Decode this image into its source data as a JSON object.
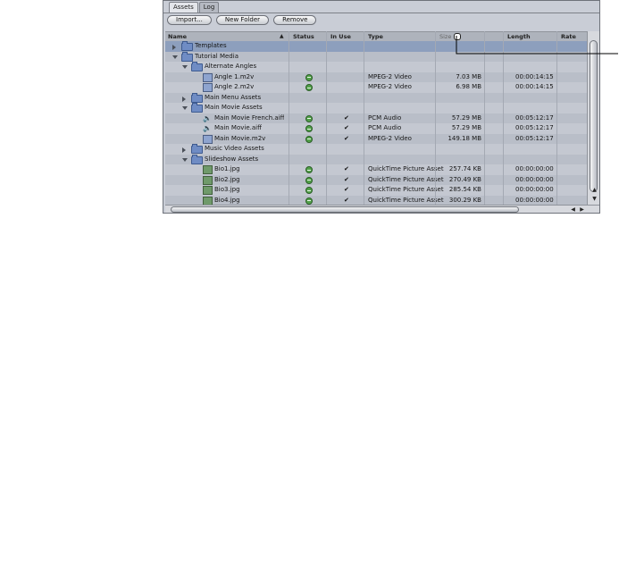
{
  "tabs": [
    {
      "label": "Assets"
    },
    {
      "label": "Log"
    }
  ],
  "toolbar": {
    "import": "Import...",
    "new_folder": "New Folder",
    "remove": "Remove"
  },
  "columns": [
    "Name",
    "Status",
    "In Use",
    "Type",
    "Size",
    "Length",
    "Rate"
  ],
  "rows": [
    {
      "name": "Templates",
      "status": "",
      "in_use": "",
      "type": "",
      "size": "",
      "length": "",
      "selected": true
    },
    {
      "name": "Tutorial Media",
      "status": "",
      "in_use": "",
      "type": "",
      "size": "",
      "length": ""
    },
    {
      "name": "Alternate Angles",
      "status": "",
      "in_use": "",
      "type": "",
      "size": "",
      "length": ""
    },
    {
      "name": "Angle 1.m2v",
      "status": "ok",
      "in_use": "",
      "type": "MPEG-2 Video",
      "size": "7.03 MB",
      "length": "00:00:14:15"
    },
    {
      "name": "Angle 2.m2v",
      "status": "ok",
      "in_use": "",
      "type": "MPEG-2 Video",
      "size": "6.98 MB",
      "length": "00:00:14:15"
    },
    {
      "name": "Main Menu Assets",
      "status": "",
      "in_use": "",
      "type": "",
      "size": "",
      "length": ""
    },
    {
      "name": "Main Movie Assets",
      "status": "",
      "in_use": "",
      "type": "",
      "size": "",
      "length": ""
    },
    {
      "name": "Main Movie French.aiff",
      "status": "ok",
      "in_use": "✔",
      "type": "PCM Audio",
      "size": "57.29 MB",
      "length": "00:05:12:17"
    },
    {
      "name": "Main Movie.aiff",
      "status": "ok",
      "in_use": "✔",
      "type": "PCM Audio",
      "size": "57.29 MB",
      "length": "00:05:12:17"
    },
    {
      "name": "Main Movie.m2v",
      "status": "ok",
      "in_use": "✔",
      "type": "MPEG-2 Video",
      "size": "149.18 MB",
      "length": "00:05:12:17"
    },
    {
      "name": "Music Video Assets",
      "status": "",
      "in_use": "",
      "type": "",
      "size": "",
      "length": ""
    },
    {
      "name": "Slideshow Assets",
      "status": "",
      "in_use": "",
      "type": "",
      "size": "",
      "length": ""
    },
    {
      "name": "Bio1.jpg",
      "status": "ok",
      "in_use": "✔",
      "type": "QuickTime Picture Asset",
      "size": "257.74 KB",
      "length": "00:00:00:00"
    },
    {
      "name": "Bio2.jpg",
      "status": "ok",
      "in_use": "✔",
      "type": "QuickTime Picture Asset",
      "size": "270.49 KB",
      "length": "00:00:00:00"
    },
    {
      "name": "Bio3.jpg",
      "status": "ok",
      "in_use": "✔",
      "type": "QuickTime Picture Asset",
      "size": "285.54 KB",
      "length": "00:00:00:00"
    },
    {
      "name": "Bio4.jpg",
      "status": "ok",
      "in_use": "✔",
      "type": "QuickTime Picture Asset",
      "size": "300.29 KB",
      "length": "00:00:00:00"
    }
  ],
  "colors": {
    "window_bg": "#c9cdd6",
    "row_selected": "#8d9fbd",
    "status_ok": "#52a14a"
  },
  "icons": {
    "folder": "folder-icon",
    "video": "video-file-icon",
    "audio": "speaker-icon",
    "image": "image-file-icon",
    "status": "status-ok-icon"
  }
}
